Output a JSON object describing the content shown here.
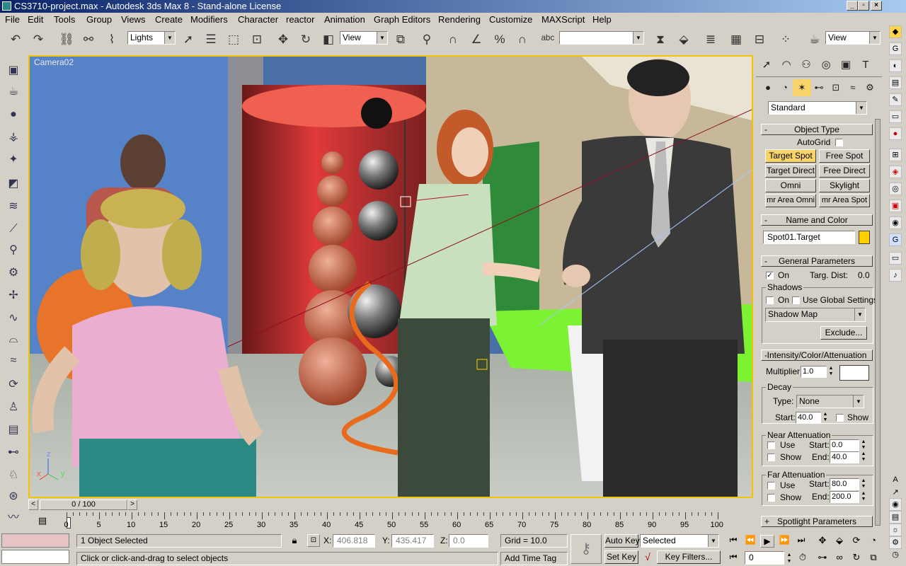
{
  "window": {
    "title": "CS3710-project.max - Autodesk 3ds Max 8  - Stand-alone License",
    "minimize": "_",
    "maximize": "▫",
    "close": "×"
  },
  "menu": [
    "File",
    "Edit",
    "Tools",
    "Group",
    "Views",
    "Create",
    "Modifiers",
    "Character",
    "reactor",
    "Animation",
    "Graph Editors",
    "Rendering",
    "Customize",
    "MAXScript",
    "Help"
  ],
  "toolbar": {
    "selection_filter": "Lights",
    "ref_coord": "View",
    "named_selection": "",
    "render_type": "View"
  },
  "viewport": {
    "label": "Camera02",
    "axis_x": "x",
    "axis_y": "y",
    "axis_z": "z"
  },
  "command_panel": {
    "category": "Standard",
    "object_type": {
      "title": "Object Type",
      "autogrid_label": "AutoGrid",
      "buttons": [
        "Target Spot",
        "Free Spot",
        "Target Direct",
        "Free Direct",
        "Omni",
        "Skylight",
        "mr Area Omni",
        "mr Area Spot"
      ],
      "active": "Target Spot"
    },
    "name_and_color": {
      "title": "Name and Color",
      "name_value": "Spot01.Target",
      "color": "#ffd000"
    },
    "general_parameters": {
      "title": "General Parameters",
      "on_label": "On",
      "targ_dist_label": "Targ. Dist:",
      "targ_dist_value": "0.0",
      "shadows_label": "Shadows",
      "shadows_on_label": "On",
      "use_global_label": "Use Global Settings",
      "shadow_type": "Shadow Map",
      "exclude_label": "Exclude..."
    },
    "intensity": {
      "title": "Intensity/Color/Attenuation",
      "multiplier_label": "Multiplier:",
      "multiplier_value": "1.0",
      "decay_label": "Decay",
      "type_label": "Type:",
      "type_value": "None",
      "start_label": "Start:",
      "start_value": "40.0",
      "show_label": "Show",
      "near_label": "Near Attenuation",
      "near_use": "Use",
      "near_show": "Show",
      "near_start_label": "Start:",
      "near_start_value": "0.0",
      "near_end_label": "End:",
      "near_end_value": "40.0",
      "far_label": "Far Attenuation",
      "far_use": "Use",
      "far_show": "Show",
      "far_start_label": "Start:",
      "far_start_value": "80.0",
      "far_end_label": "End:",
      "far_end_value": "200.0"
    },
    "spotlight": {
      "title": "Spotlight Parameters"
    }
  },
  "timeline": {
    "frame_display": "0 / 100",
    "ticks": [
      "0",
      "5",
      "10",
      "15",
      "20",
      "25",
      "30",
      "35",
      "40",
      "45",
      "50",
      "55",
      "60",
      "65",
      "70",
      "75",
      "80",
      "85",
      "90",
      "95",
      "100"
    ]
  },
  "status": {
    "selection": "1 Object Selected",
    "prompt": "Click or click-and-drag to select objects",
    "x_label": "X:",
    "x_value": "406.818",
    "y_label": "Y:",
    "y_value": "435.417",
    "z_label": "Z:",
    "z_value": "0.0",
    "grid": "Grid = 10.0",
    "add_time_tag": "Add Time Tag",
    "auto_key": "Auto Key",
    "set_key": "Set Key",
    "key_mode": "Selected",
    "key_filters": "Key Filters...",
    "current_frame": "0"
  }
}
